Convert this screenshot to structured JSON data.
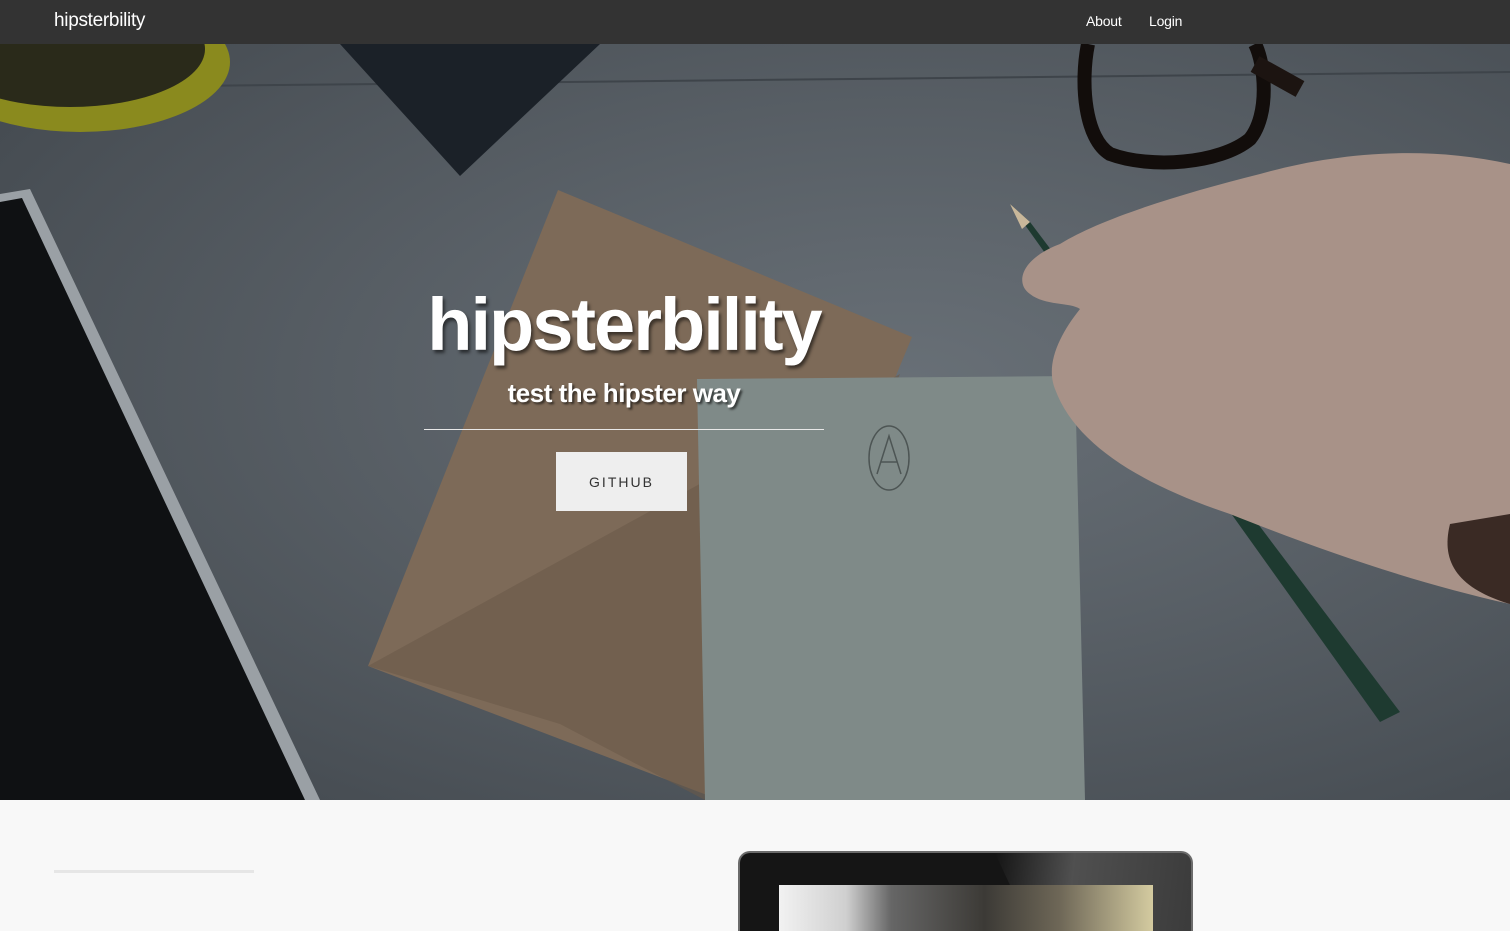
{
  "navbar": {
    "brand": "hipsterbility",
    "links": [
      {
        "label": "About"
      },
      {
        "label": "Login"
      }
    ]
  },
  "hero": {
    "title": "hipsterbility",
    "subtitle": "test the hipster way",
    "button_label": "GITHUB"
  },
  "colors": {
    "navbar_bg": "#333333",
    "button_bg": "#eeeeee",
    "section_bg": "#f8f8f8"
  }
}
